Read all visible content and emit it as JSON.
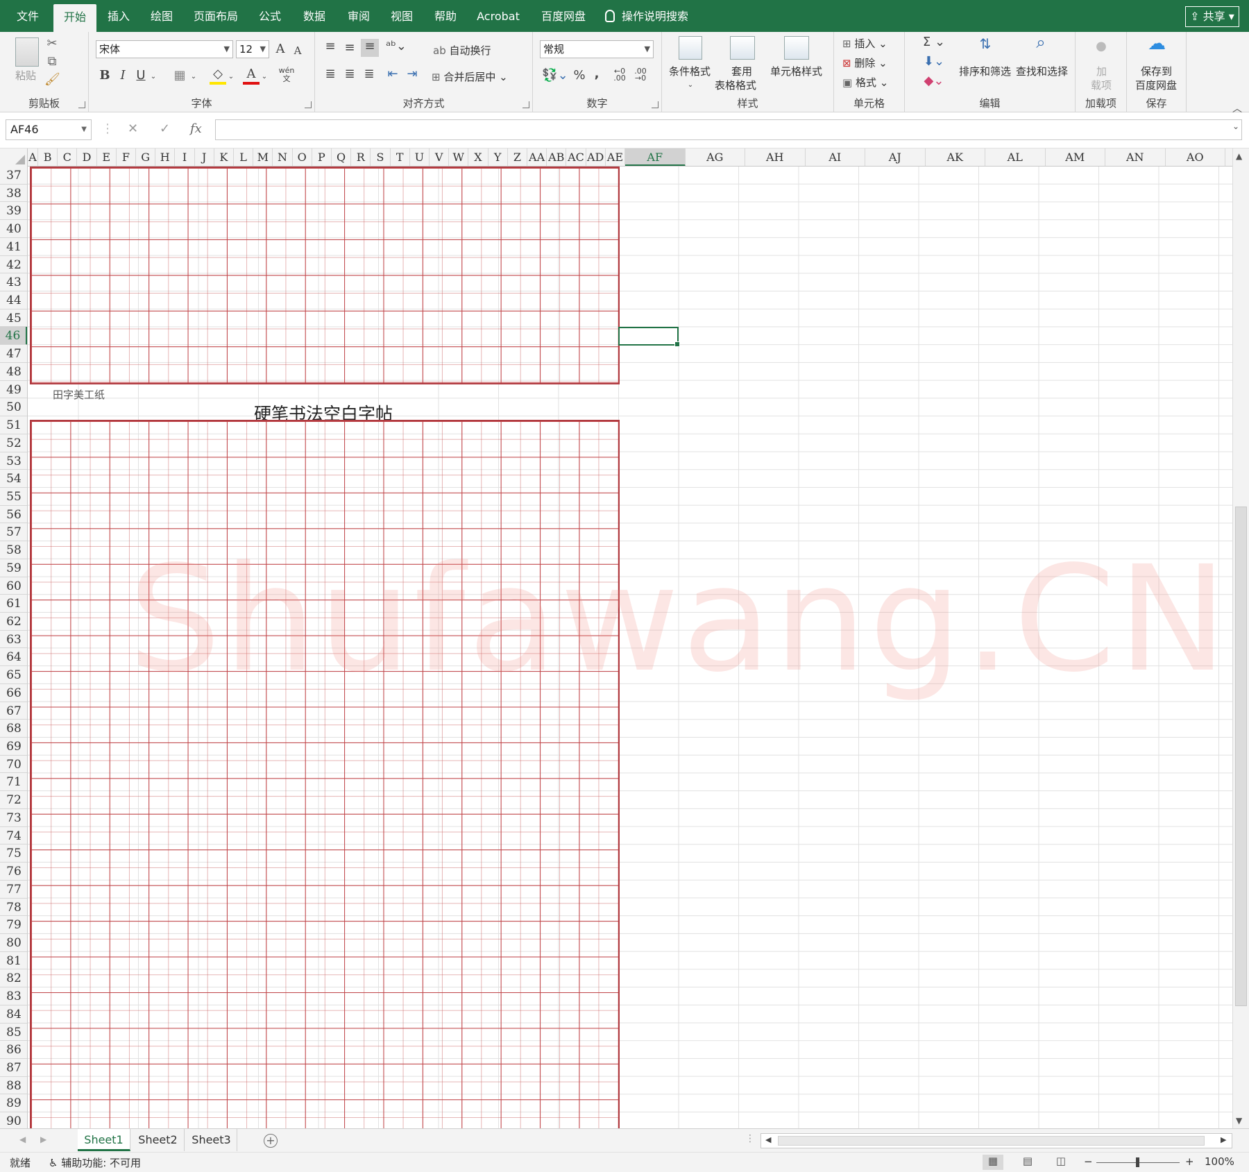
{
  "tabs": [
    "文件",
    "开始",
    "插入",
    "绘图",
    "页面布局",
    "公式",
    "数据",
    "审阅",
    "视图",
    "帮助",
    "Acrobat",
    "百度网盘"
  ],
  "active_tab": "开始",
  "tell_me": "操作说明搜索",
  "share": "共享",
  "ribbon": {
    "clipboard": {
      "paste": "粘贴",
      "label": "剪贴板"
    },
    "font": {
      "name": "宋体",
      "size": "12",
      "grow": "A",
      "shrink": "A",
      "bold": "B",
      "italic": "I",
      "underline": "U",
      "phonetic": "wén",
      "label": "字体"
    },
    "alignment": {
      "wrap": "自动换行",
      "merge": "合并后居中",
      "label": "对齐方式"
    },
    "number": {
      "format": "常规",
      "percent": "%",
      "comma": ",",
      "label": "数字"
    },
    "styles": {
      "conditional": "条件格式",
      "table_line1": "套用",
      "table_line2": "表格格式",
      "cell_styles": "单元格样式",
      "label": "样式"
    },
    "cells": {
      "insert": "插入",
      "delete": "删除",
      "format": "格式",
      "label": "单元格"
    },
    "editing": {
      "sort_filter": "排序和筛选",
      "find_select": "查找和选择",
      "label": "编辑"
    },
    "addins": {
      "line1": "加",
      "line2": "载项",
      "label": "加载项"
    },
    "save": {
      "line1": "保存到",
      "line2": "百度网盘",
      "label": "保存"
    }
  },
  "formula_bar": {
    "name_box": "AF46",
    "fx": "fx",
    "value": ""
  },
  "columns_narrow": [
    "A",
    "B",
    "C",
    "D",
    "E",
    "F",
    "G",
    "H",
    "I",
    "J",
    "K",
    "L",
    "M",
    "N",
    "O",
    "P",
    "Q",
    "R",
    "S",
    "T",
    "U",
    "V",
    "W",
    "X",
    "Y",
    "Z",
    "AA",
    "AB",
    "AC",
    "AD",
    "AE"
  ],
  "columns_wide": [
    "AF",
    "AG",
    "AH",
    "AI",
    "AJ",
    "AK",
    "AL",
    "AM",
    "AN",
    "AO"
  ],
  "selected_column": "AF",
  "first_row": 37,
  "last_row": 90,
  "selected_row": 46,
  "paper_caption": "田字美工纸",
  "paper_title": "硬笔书法空白字帖",
  "watermark": "Shufawang.CN",
  "sheets": [
    "Sheet1",
    "Sheet2",
    "Sheet3"
  ],
  "active_sheet": "Sheet1",
  "status": {
    "ready": "就绪",
    "accessibility": "辅助功能: 不可用",
    "zoom": "100%"
  }
}
